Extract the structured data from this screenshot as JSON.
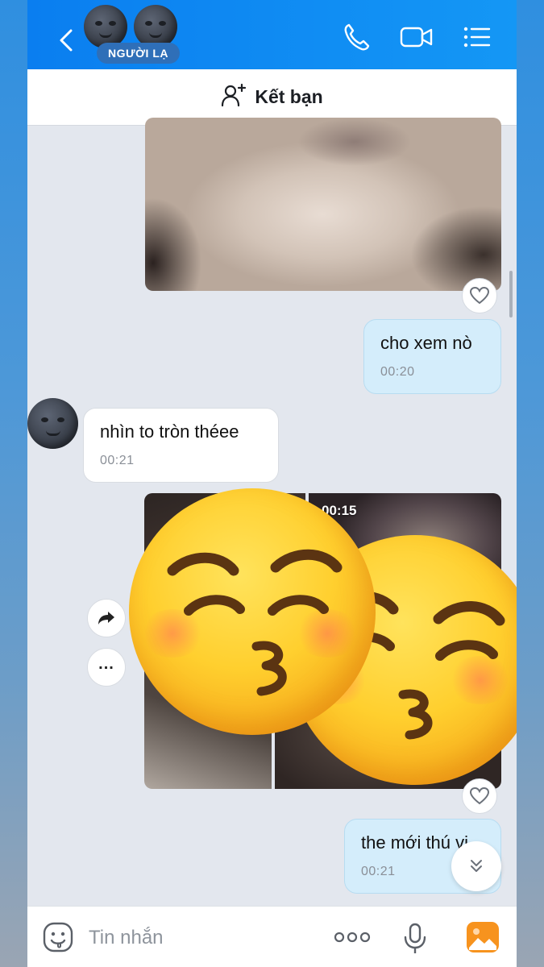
{
  "header": {
    "title_badge": "NGƯỜI LẠ",
    "icons": [
      "back-icon",
      "moon-face-avatar",
      "phone-icon",
      "video-camera-icon",
      "list-menu-icon"
    ]
  },
  "add_friend": {
    "label": "Kết bạn",
    "icon": "add-person-icon"
  },
  "messages": [
    {
      "type": "image",
      "direction": "out",
      "reaction_icon": "heart-icon"
    },
    {
      "type": "text",
      "direction": "out",
      "text": "cho xem nò",
      "time": "00:20"
    },
    {
      "type": "text",
      "direction": "in",
      "text": "nhìn to tròn théee",
      "time": "00:21"
    },
    {
      "type": "media-grid",
      "direction": "out",
      "video_duration": "00:15",
      "reaction_icon": "heart-icon"
    },
    {
      "type": "text",
      "direction": "out",
      "text": "the mới thú vị",
      "time": "00:21"
    }
  ],
  "overlay_stickers": [
    "kissing-face-with-closed-eyes-emoji",
    "kissing-face-with-closed-eyes-emoji"
  ],
  "input_bar": {
    "placeholder": "Tin nhắn",
    "icons": [
      "sticker-icon",
      "more-options-icon",
      "microphone-icon",
      "image-gallery-icon"
    ]
  },
  "colors": {
    "header_blue": "#0a7ef0",
    "outgoing_bubble": "#d4edfb",
    "incoming_bubble": "#ffffff",
    "chat_background": "#e3e7ee",
    "gallery_icon": "#f7931e"
  }
}
